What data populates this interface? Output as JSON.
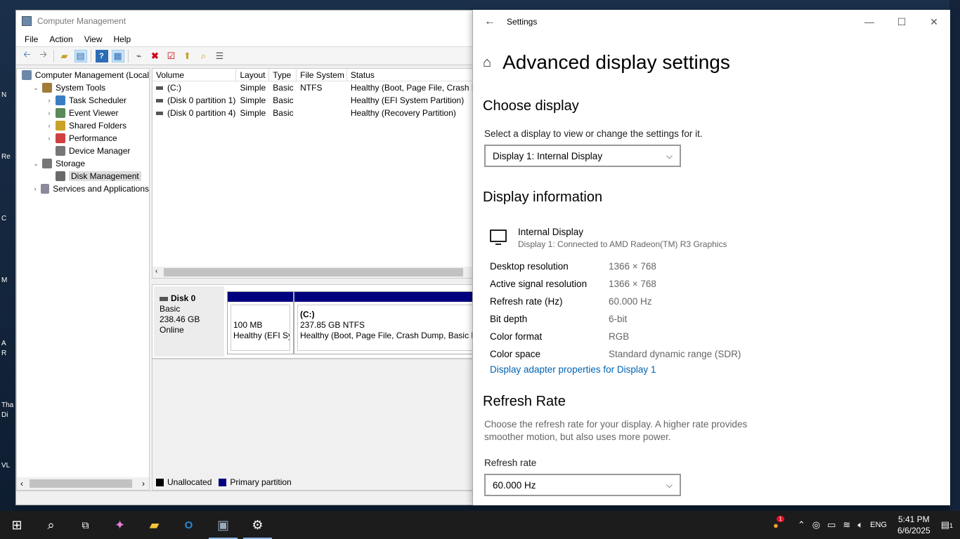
{
  "desktop": {
    "fragments": [
      "N",
      "Re",
      "C",
      "M",
      "A",
      "R",
      "Tha",
      "Di",
      "VL"
    ]
  },
  "cm": {
    "title": "Computer Management",
    "menu": [
      "File",
      "Action",
      "View",
      "Help"
    ],
    "tree": [
      {
        "label": "Computer Management (Local",
        "indent": 0,
        "tw": ""
      },
      {
        "label": "System Tools",
        "indent": 1,
        "tw": "⌄"
      },
      {
        "label": "Task Scheduler",
        "indent": 2,
        "tw": "›"
      },
      {
        "label": "Event Viewer",
        "indent": 2,
        "tw": "›"
      },
      {
        "label": "Shared Folders",
        "indent": 2,
        "tw": "›"
      },
      {
        "label": "Performance",
        "indent": 2,
        "tw": "›"
      },
      {
        "label": "Device Manager",
        "indent": 2,
        "tw": ""
      },
      {
        "label": "Storage",
        "indent": 1,
        "tw": "⌄"
      },
      {
        "label": "Disk Management",
        "indent": 2,
        "tw": "",
        "selected": true
      },
      {
        "label": "Services and Applications",
        "indent": 1,
        "tw": "›"
      }
    ],
    "vol_headers": [
      "Volume",
      "Layout",
      "Type",
      "File System",
      "Status"
    ],
    "volumes": [
      [
        "(C:)",
        "Simple",
        "Basic",
        "NTFS",
        "Healthy (Boot, Page File, Crash D"
      ],
      [
        "(Disk 0 partition 1)",
        "Simple",
        "Basic",
        "",
        "Healthy (EFI System Partition)"
      ],
      [
        "(Disk 0 partition 4)",
        "Simple",
        "Basic",
        "",
        "Healthy (Recovery Partition)"
      ]
    ],
    "disk": {
      "name": "Disk 0",
      "type": "Basic",
      "size": "238.46 GB",
      "status": "Online"
    },
    "partitions": [
      {
        "title": "",
        "size": "100 MB",
        "status": "Healthy (EFI Sys"
      },
      {
        "title": "(C:)",
        "size": "237.85 GB NTFS",
        "status": "Healthy (Boot, Page File, Crash Dump, Basic Da"
      }
    ],
    "legend": [
      {
        "label": "Unallocated",
        "color": "#000000"
      },
      {
        "label": "Primary partition",
        "color": "#00007e"
      }
    ]
  },
  "settings": {
    "window_title": "Settings",
    "page_title": "Advanced display settings",
    "choose_display": {
      "heading": "Choose display",
      "subtext": "Select a display to view or change the settings for it.",
      "selected": "Display 1: Internal Display"
    },
    "display_info": {
      "heading": "Display information",
      "name": "Internal Display",
      "sub": "Display 1: Connected to AMD Radeon(TM) R3 Graphics",
      "props": [
        {
          "k": "Desktop resolution",
          "v": "1366 × 768"
        },
        {
          "k": "Active signal resolution",
          "v": "1366 × 768"
        },
        {
          "k": "Refresh rate (Hz)",
          "v": "60.000 Hz"
        },
        {
          "k": "Bit depth",
          "v": "6-bit"
        },
        {
          "k": "Color format",
          "v": "RGB"
        },
        {
          "k": "Color space",
          "v": "Standard dynamic range (SDR)"
        }
      ],
      "link": "Display adapter properties for Display 1"
    },
    "refresh": {
      "heading": "Refresh Rate",
      "desc": "Choose the refresh rate for your display. A higher rate provides smoother motion, but also uses more power.",
      "label": "Refresh rate",
      "selected": "60.000 Hz"
    }
  },
  "taskbar": {
    "lang": "ENG",
    "time": "5:41 PM",
    "date": "6/6/2025",
    "notif_badge": "1",
    "notif_count": "1"
  }
}
